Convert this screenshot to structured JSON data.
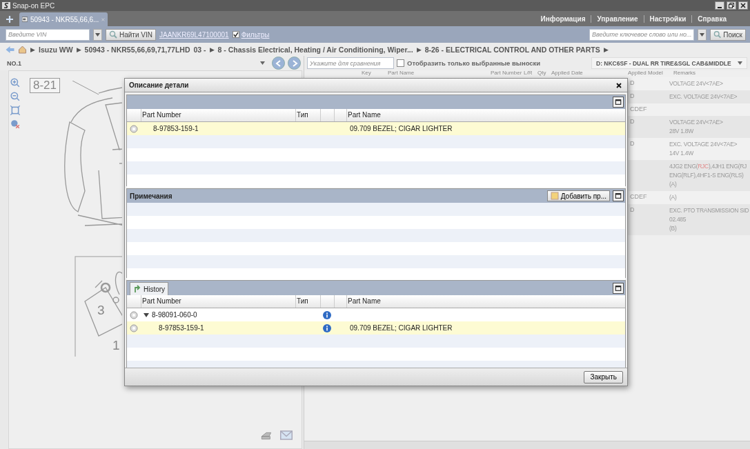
{
  "window": {
    "title": "Snap-on EPC"
  },
  "tab_bar": {
    "tabs": [
      {
        "label": "50943 - NKR55,66,6...",
        "selected": true
      }
    ],
    "menu": [
      "Информация",
      "Управление",
      "Настройки",
      "Справка"
    ]
  },
  "toolbar": {
    "vin_placeholder": "Введите VIN",
    "find_vin_button": "Найти VIN",
    "vin_link": "JAANKR69L47100001",
    "filters": {
      "label": "Фильтры",
      "checked": true
    },
    "search_placeholder": "Введите ключевое слово или но...",
    "search_button": "Поиск"
  },
  "breadcrumb": [
    {
      "kind": "sep",
      "text": "▶"
    },
    {
      "kind": "crumb",
      "text": "Isuzu WW"
    },
    {
      "kind": "sep",
      "text": "▶"
    },
    {
      "kind": "crumb",
      "text": "50943 - NKR55,66,69,71,77LHD"
    },
    {
      "kind": "crumb",
      "text": "03 -"
    },
    {
      "kind": "sep",
      "text": "▶"
    },
    {
      "kind": "crumb",
      "text": "8 - Chassis Electrical, Heating / Air Conditioning, Wiper..."
    },
    {
      "kind": "sep",
      "text": "▶"
    },
    {
      "kind": "crumb",
      "text": "8-26 - ELECTRICAL CONTROL AND OTHER PARTS"
    },
    {
      "kind": "sep",
      "text": "▶"
    }
  ],
  "diagram_pane": {
    "selector": "NO.1",
    "callouts": [
      "8-21",
      "3",
      "1"
    ]
  },
  "parts_pane": {
    "compare_placeholder": "Укажите для сравнения",
    "only_selected": {
      "label": "Отобразить только выбранные выноски",
      "checked": false
    },
    "variant": "D: NKC6SF - DUAL RR TIRE&SGL CAB&MIDDLE",
    "columns": [
      "Key",
      "Part Name",
      "Part Number",
      "L/R",
      "Qty",
      "Applied Date",
      "Applied Model",
      "Remarks"
    ],
    "rows": [
      {
        "applied_model": "D",
        "remarks": [
          [
            {
              "kind": "plain",
              "text": "VOLTAGE 24V<7AE>"
            }
          ]
        ]
      },
      {
        "applied_model": "D",
        "remarks": [
          [
            {
              "kind": "plain",
              "text": "EXC. VOLTAGE 24V<7AE>"
            }
          ]
        ]
      },
      {
        "applied_model": "CDEF",
        "remarks": []
      },
      {
        "applied_model": "D",
        "remarks": [
          [
            {
              "kind": "plain",
              "text": "VOLTAGE 24V<7AE>"
            }
          ],
          [
            {
              "kind": "plain",
              "text": "28V 1.8W"
            }
          ]
        ]
      },
      {
        "applied_model": "D",
        "remarks": [
          [
            {
              "kind": "plain",
              "text": "EXC. VOLTAGE 24V<7AE>"
            }
          ],
          [
            {
              "kind": "plain",
              "text": "14V 1.4W"
            }
          ]
        ]
      },
      {
        "applied_model": "",
        "remarks": [
          [
            {
              "kind": "plain",
              "text": "4JG2 ENG("
            },
            {
              "kind": "alert",
              "text": "RJC"
            },
            {
              "kind": "plain",
              "text": "),4JH1 ENG(RJ"
            }
          ],
          [
            {
              "kind": "plain",
              "text": "ENG(RLF),4HF1-S ENG(RLS)"
            }
          ],
          [
            {
              "kind": "plain",
              "text": "(A)"
            }
          ]
        ]
      },
      {
        "applied_model": "CDEF",
        "remarks": [
          [
            {
              "kind": "plain",
              "text": "(A)"
            }
          ]
        ]
      },
      {
        "applied_model": "D",
        "remarks": [
          [
            {
              "kind": "plain",
              "text": "EXC. PTO TRANSMISSION SID"
            }
          ],
          [
            {
              "kind": "plain",
              "text": "02.485"
            }
          ],
          [
            {
              "kind": "plain",
              "text": "(B)"
            }
          ]
        ]
      }
    ]
  },
  "dialog": {
    "title": "Описание детали",
    "parts": {
      "columns": [
        "Part Number",
        "Тип",
        "",
        "",
        "Part Name"
      ],
      "rows": [
        {
          "part_number": "8-97853-159-1",
          "part_name": "09.709 BEZEL; CIGAR LIGHTER",
          "selected": true
        }
      ]
    },
    "notes": {
      "title": "Примечания",
      "add_button": "Добавить пр..."
    },
    "history": {
      "tab": "History",
      "columns": [
        "Part Number",
        "Тип",
        "",
        "",
        "Part Name"
      ],
      "rows": [
        {
          "part_number": "8-98091-060-0",
          "part_name": "",
          "selected": false,
          "expanded": true,
          "children": [
            {
              "part_number": "8-97853-159-1",
              "part_name": "09.709 BEZEL; CIGAR LIGHTER",
              "selected": true
            }
          ]
        }
      ]
    },
    "close_button": "Закрыть"
  }
}
